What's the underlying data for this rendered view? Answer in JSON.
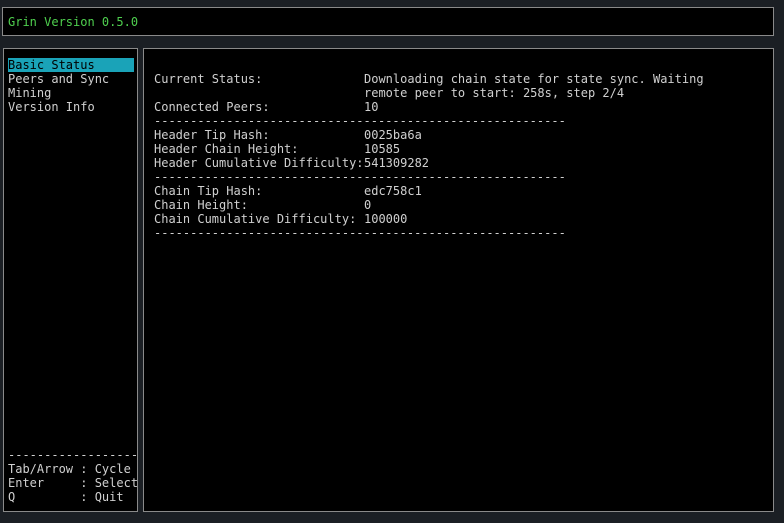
{
  "app": {
    "title": "Grin Version 0.5.0",
    "title_color": "#4fd04f",
    "accent": "#1aa3b8"
  },
  "sidebar": {
    "items": [
      {
        "label": "Basic Status",
        "selected": true
      },
      {
        "label": "Peers and Sync",
        "selected": false
      },
      {
        "label": "Mining",
        "selected": false
      },
      {
        "label": "Version Info",
        "selected": false
      }
    ],
    "help": {
      "separator": "------------------",
      "lines": [
        "Tab/Arrow : Cycle",
        "Enter     : Select",
        "Q         : Quit"
      ]
    }
  },
  "status": {
    "separator": "---------------------------------------------------------",
    "current_status": {
      "label": "Current Status:",
      "value": "Downloading chain state for state sync. Waiting remote peer to start: 258s, step 2/4"
    },
    "connected_peers": {
      "label": "Connected Peers:",
      "value": "10"
    },
    "header_tip_hash": {
      "label": "Header Tip Hash:",
      "value": "0025ba6a"
    },
    "header_chain_height": {
      "label": "Header Chain Height:",
      "value": "10585"
    },
    "header_cumulative_difficulty": {
      "label": "Header Cumulative Difficulty:",
      "value": "541309282"
    },
    "chain_tip_hash": {
      "label": "Chain Tip Hash:",
      "value": "edc758c1"
    },
    "chain_height": {
      "label": "Chain Height:",
      "value": "0"
    },
    "chain_cumulative_difficulty": {
      "label": "Chain Cumulative Difficulty:",
      "value": "100000"
    }
  }
}
